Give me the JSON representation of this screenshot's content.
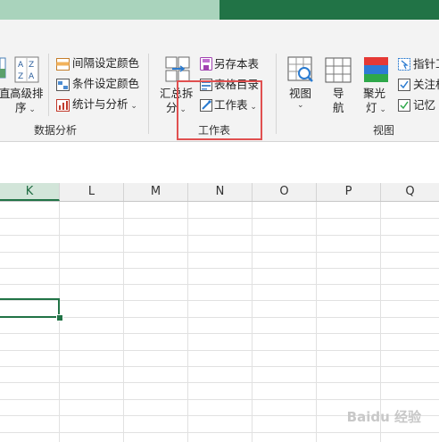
{
  "ribbon": {
    "group_data_analysis": {
      "label": "数据分析",
      "partial_left_label": "直",
      "advanced_sort": {
        "line1": "高级排",
        "line2": "序"
      },
      "interval_color": "间隔设定颜色",
      "conditional_color": "条件设定颜色",
      "stats_analysis": "统计与分析"
    },
    "group_worksheet": {
      "label": "工作表",
      "summarize_split": {
        "line1": "汇总拆",
        "line2": "分"
      },
      "save_as": "另存本表",
      "table_directory": "表格目录",
      "worksheet": "工作表"
    },
    "group_view": {
      "label": "视图",
      "view": "视图",
      "navigation": {
        "line1": "导",
        "line2": "航"
      },
      "spotlight": {
        "line1": "聚光",
        "line2": "灯"
      },
      "pointer_partial": "指针工",
      "focus_partial": "关注相",
      "memory_partial": "记忆"
    }
  },
  "grid": {
    "columns": [
      "K",
      "L",
      "M",
      "N",
      "O",
      "P",
      "Q"
    ]
  },
  "watermark": "Baidu 经验"
}
